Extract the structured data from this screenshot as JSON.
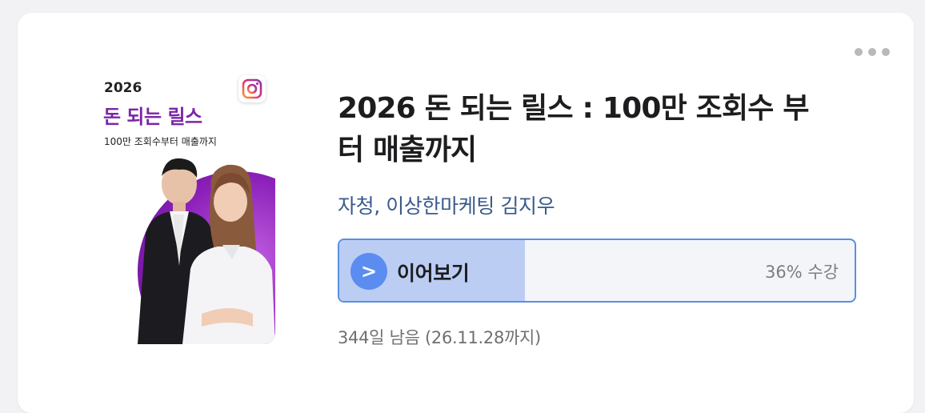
{
  "course": {
    "title": "2026 돈 되는 릴스 : 100만 조회수 부터 매출까지",
    "author": "자청, 이상한마케팅 김지우",
    "thumbnail": {
      "year": "2026",
      "title": "돈 되는 릴스",
      "subtitle": "100만 조회수부터 매출까지",
      "badge_icon": "instagram-icon",
      "accent_color": "#7a26a8"
    }
  },
  "progress": {
    "resume_label": "이어보기",
    "play_glyph": ">",
    "percent_text": "36% 수강",
    "fraction": 0.36,
    "bar_color": "#bccdf3",
    "border_color": "#5b8ee0"
  },
  "expiry": {
    "text": "344일 남음 (26.11.28까지)"
  },
  "menu": {
    "icon": "more-dots-icon"
  }
}
